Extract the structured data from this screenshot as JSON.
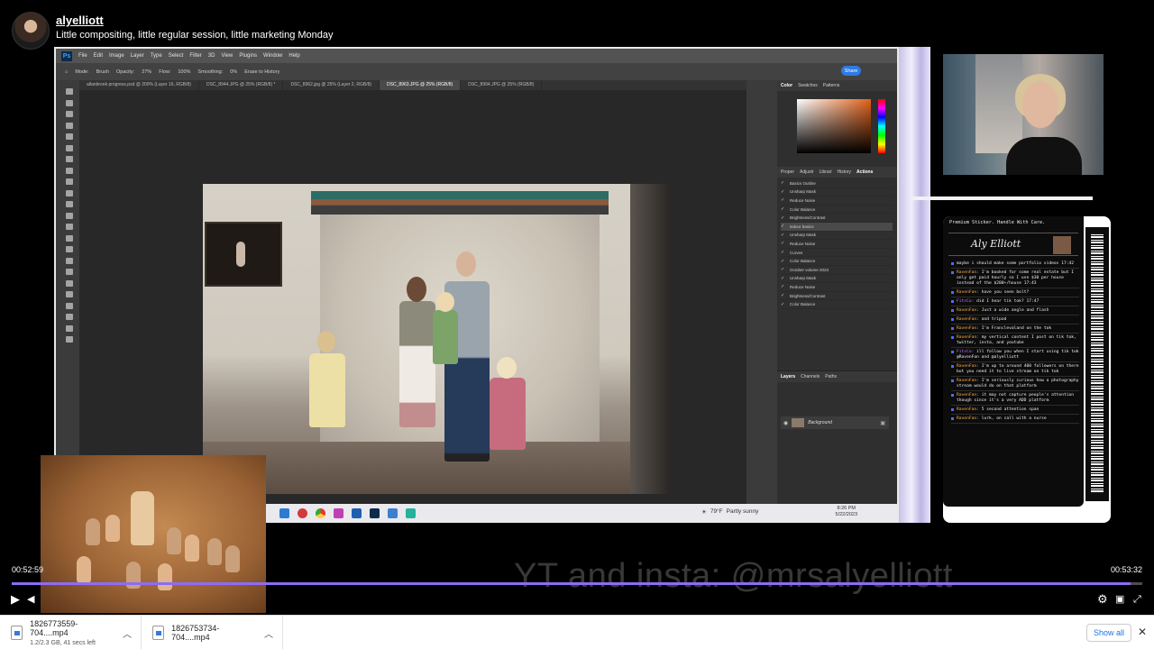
{
  "channel": {
    "name": "alyelliott",
    "stream_title": "Little compositing, little regular session, little marketing Monday"
  },
  "photoshop": {
    "logo": "Ps",
    "menu": [
      "File",
      "Edit",
      "Image",
      "Layer",
      "Type",
      "Select",
      "Filter",
      "3D",
      "View",
      "Plugins",
      "Window",
      "Help"
    ],
    "options": [
      "Mode:",
      "Brush",
      "Opacity:",
      "27%",
      "Flow:",
      "100%",
      "Smoothing:",
      "0%",
      "Erase to History"
    ],
    "share_label": "Share",
    "tabs": [
      {
        "label": "allanbrook progress.psd @ 200% (Layer 16, RGB/8)",
        "active": false
      },
      {
        "label": "DSC_8944.JPG @ 25% (RGB/8) *",
        "active": false
      },
      {
        "label": "DSC_8962.jpg @ 25% (Layer 2, RGB/8)",
        "active": false
      },
      {
        "label": "DSC_8963.JPG @ 25% (RGB/8)",
        "active": true
      },
      {
        "label": "DSC_8994.JPG @ 25% (RGB/8)",
        "active": false
      }
    ],
    "color_panel_tabs": [
      "Color",
      "Swatches",
      "Patterns"
    ],
    "actions_panel_tabs": [
      "Proper",
      "Adjustr",
      "Librari",
      "History",
      "Actions"
    ],
    "actions": [
      {
        "label": "Basics Outline",
        "sel": false
      },
      {
        "label": "Unsharp Mask",
        "sel": false
      },
      {
        "label": "Reduce Noise",
        "sel": false
      },
      {
        "label": "Color Balance",
        "sel": false
      },
      {
        "label": "Brightness/Contrast",
        "sel": false
      },
      {
        "label": "indoor basics",
        "sel": true
      },
      {
        "label": "Unsharp Mask",
        "sel": false
      },
      {
        "label": "Reduce Noise",
        "sel": false
      },
      {
        "label": "Curves",
        "sel": false
      },
      {
        "label": "Color Balance",
        "sel": false
      },
      {
        "label": "October volume 2023",
        "sel": false
      },
      {
        "label": "Unsharp Mask",
        "sel": false
      },
      {
        "label": "Reduce Noise",
        "sel": false
      },
      {
        "label": "Brightness/Contrast",
        "sel": false
      },
      {
        "label": "Color Balance",
        "sel": false
      }
    ],
    "layers_tabs": [
      "Layers",
      "Channels",
      "Paths"
    ],
    "layer_name": "Background",
    "taskbar": {
      "temperature": "79°F",
      "weather": "Partly sunny",
      "time": "8:26 PM",
      "date": "5/22/2023"
    }
  },
  "chat": {
    "header": "Premium Sticker. Handle With Care.",
    "signature": "Aly Elliott",
    "messages": [
      {
        "user": "",
        "text": "maybe i should make some portfolio videos",
        "time": "17:42"
      },
      {
        "user": "RavenFan:",
        "text": "I'm booked for some real estate but I only get paid hourly so I use $30 per house instead of the $200+/house",
        "time": "17:43"
      },
      {
        "user": "RavenFan:",
        "text": "have you seen bolt?",
        "time": ""
      },
      {
        "user": "FitsCo:",
        "text": "did I hear tik tok?",
        "time": "17:47"
      },
      {
        "user": "RavenFan:",
        "text": "Just a wide angle and flash",
        "time": ""
      },
      {
        "user": "RavenFan:",
        "text": "and tripod",
        "time": ""
      },
      {
        "user": "RavenFan:",
        "text": "I'm Franclevaland on the tok",
        "time": ""
      },
      {
        "user": "RavenFan:",
        "text": "my vertical content I post on tik tok, twitter, insta, and youtube",
        "time": ""
      },
      {
        "user": "FitsCo:",
        "text": "ill follow you when I start using tik tok @RavenFan and @alyelliott",
        "time": ""
      },
      {
        "user": "RavenFan:",
        "text": "I'm up to around 400 followers on there but you need it to live stream on tik tok",
        "time": ""
      },
      {
        "user": "RavenFan:",
        "text": "I'm seriously curious how a photography stream would do on that platform",
        "time": ""
      },
      {
        "user": "RavenFan:",
        "text": "it may not capture people's attention though since it's a very ADD platform",
        "time": ""
      },
      {
        "user": "RavenFan:",
        "text": "5 second attention span",
        "time": ""
      },
      {
        "user": "RavenFan:",
        "text": "lurk, on call with a nurse",
        "time": ""
      }
    ]
  },
  "overlay": {
    "watermark": "YT and insta: @mrsalyelliott"
  },
  "player": {
    "current_time": "00:52:59",
    "duration": "00:53:32",
    "progress": 0.99,
    "accent": "#8e6cf3",
    "play_icon": "play-icon",
    "volume_icon": "volume-icon",
    "settings_icon": "gear-icon",
    "miniplayer_icon": "miniplayer-icon",
    "fullscreen_icon": "fullscreen-icon"
  },
  "downloads": {
    "items": [
      {
        "name": "1826773559-704....mp4",
        "status": "1.2/2.3 GB, 41 secs left"
      },
      {
        "name": "1826753734-704....mp4",
        "status": ""
      }
    ],
    "show_all": "Show all"
  }
}
